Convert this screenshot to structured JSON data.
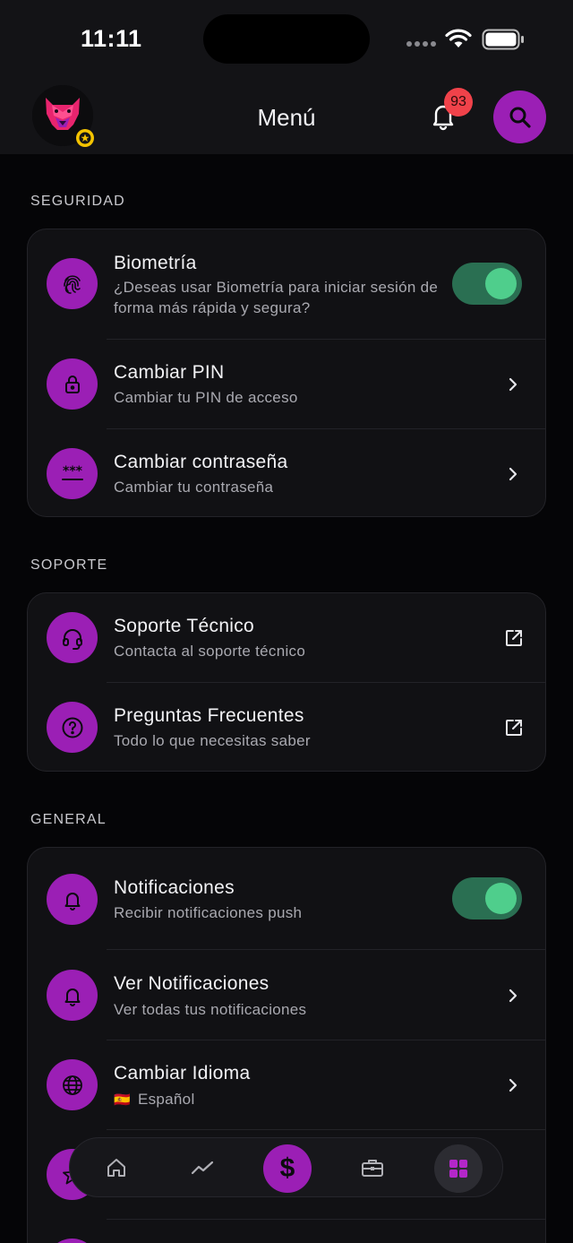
{
  "status_bar": {
    "time": "11:11"
  },
  "header": {
    "title": "Menú",
    "notification_count": "93"
  },
  "sections": {
    "security": {
      "label": "SEGURIDAD",
      "items": [
        {
          "title": "Biometría",
          "subtitle": "¿Deseas usar Biometría para iniciar sesión de forma más rápida y segura?",
          "icon": "fingerprint-icon",
          "toggle_on": true
        },
        {
          "title": "Cambiar PIN",
          "subtitle": "Cambiar tu PIN de acceso",
          "icon": "lock-icon"
        },
        {
          "title": "Cambiar contraseña",
          "subtitle": "Cambiar tu contraseña",
          "icon": "password-icon"
        }
      ]
    },
    "support": {
      "label": "SOPORTE",
      "items": [
        {
          "title": "Soporte Técnico",
          "subtitle": "Contacta al soporte técnico",
          "icon": "headset-icon"
        },
        {
          "title": "Preguntas Frecuentes",
          "subtitle": "Todo lo que necesitas saber",
          "icon": "help-circle-icon"
        }
      ]
    },
    "general": {
      "label": "GENERAL",
      "items": [
        {
          "title": "Notificaciones",
          "subtitle": "Recibir notificaciones push",
          "icon": "bell-icon",
          "toggle_on": true
        },
        {
          "title": "Ver Notificaciones",
          "subtitle": "Ver todas tus notificaciones",
          "icon": "bell-icon"
        },
        {
          "title": "Cambiar Idioma",
          "subtitle": "Español",
          "flag": "🇪🇸",
          "icon": "globe-icon"
        }
      ]
    }
  },
  "tabbar": {
    "tabs": [
      "home-icon",
      "chart-icon",
      "dollar-icon",
      "briefcase-icon",
      "grid-icon"
    ],
    "dollar_label": "$"
  },
  "colors": {
    "accent": "#9b1fb5",
    "toggle_on": "#4fce8c",
    "badge": "#f0424a"
  }
}
